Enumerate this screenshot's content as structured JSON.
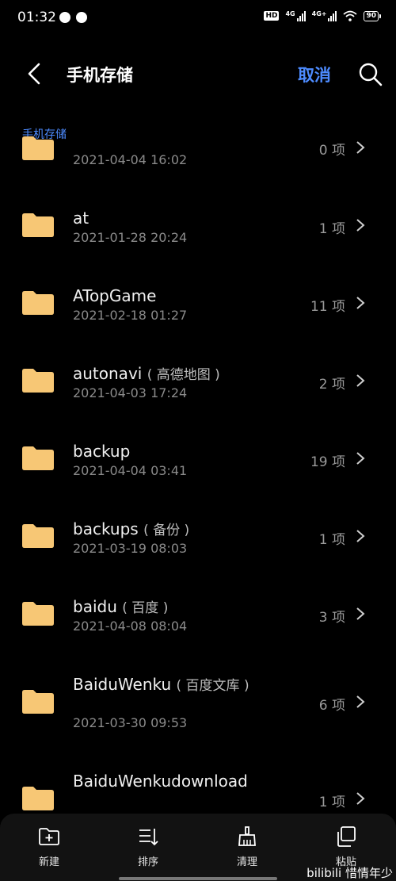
{
  "status": {
    "time": "01:32",
    "hd": "HD",
    "net1": "4G",
    "net2": "4G+",
    "battery": "90"
  },
  "header": {
    "title": "手机存储",
    "cancel_label": "取消"
  },
  "breadcrumb": "手机存储",
  "files": [
    {
      "name": "",
      "alias": "",
      "date": "2021-04-04 16:02",
      "count": "0 项"
    },
    {
      "name": "at",
      "alias": "",
      "date": "2021-01-28 20:24",
      "count": "1 项"
    },
    {
      "name": "ATopGame",
      "alias": "",
      "date": "2021-02-18 01:27",
      "count": "11 项"
    },
    {
      "name": "autonavi",
      "alias": "( 高德地图 )",
      "date": "2021-04-03 17:24",
      "count": "2 项"
    },
    {
      "name": "backup",
      "alias": "",
      "date": "2021-04-04 03:41",
      "count": "19 项"
    },
    {
      "name": "backups",
      "alias": "( 备份 )",
      "date": "2021-03-19 08:03",
      "count": "1 项"
    },
    {
      "name": "baidu",
      "alias": "( 百度 )",
      "date": "2021-04-08 08:04",
      "count": "3 项"
    },
    {
      "name": "BaiduWenku",
      "alias": "( 百度文库 )",
      "date": "2021-03-30 09:53",
      "count": "6 项"
    },
    {
      "name": "BaiduWenkudownload",
      "alias": "",
      "date": "",
      "count": "1 项"
    }
  ],
  "toolbar": {
    "new_label": "新建",
    "sort_label": "排序",
    "clean_label": "清理",
    "paste_label": "粘贴"
  },
  "watermark": "bilibili 惜情年少",
  "colors": {
    "accent": "#4d8bff",
    "folder": "#f7c775",
    "background": "#000000"
  }
}
